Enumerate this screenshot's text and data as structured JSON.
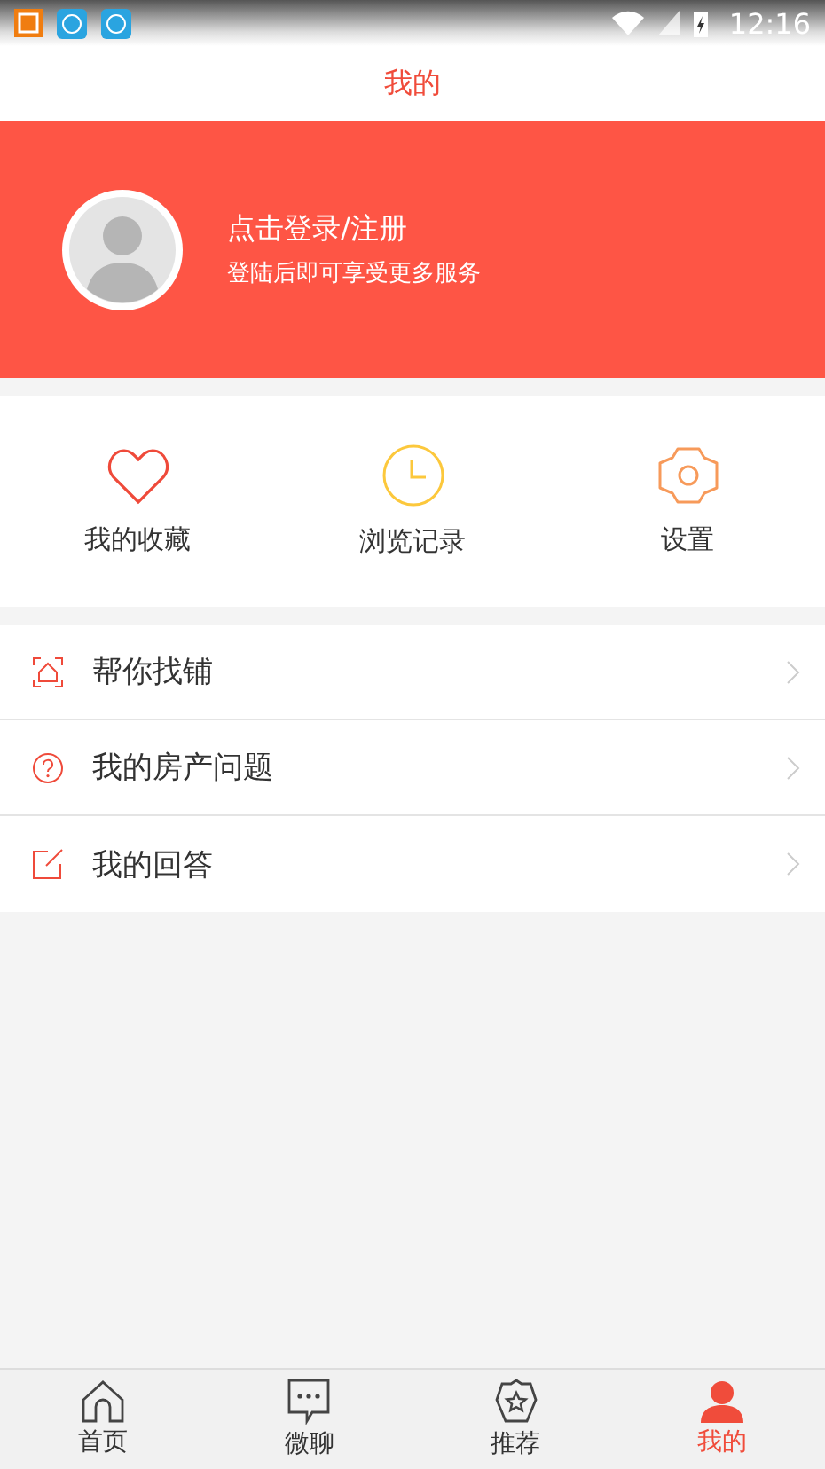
{
  "status_bar": {
    "time": "12:16"
  },
  "title": "我的",
  "profile": {
    "login": "点击登录/注册",
    "subtitle": "登陆后即可享受更多服务"
  },
  "shortcuts": [
    {
      "kind": "heart",
      "label": "我的收藏"
    },
    {
      "kind": "clock",
      "label": "浏览记录"
    },
    {
      "kind": "gear",
      "label": "设置"
    }
  ],
  "menu": [
    {
      "kind": "house",
      "label": "帮你找铺"
    },
    {
      "kind": "question",
      "label": "我的房产问题"
    },
    {
      "kind": "edit",
      "label": "我的回答"
    }
  ],
  "tabs": [
    {
      "kind": "home",
      "label": "首页",
      "selected": false
    },
    {
      "kind": "chat",
      "label": "微聊",
      "selected": false
    },
    {
      "kind": "star",
      "label": "推荐",
      "selected": false
    },
    {
      "kind": "person",
      "label": "我的",
      "selected": true
    }
  ]
}
